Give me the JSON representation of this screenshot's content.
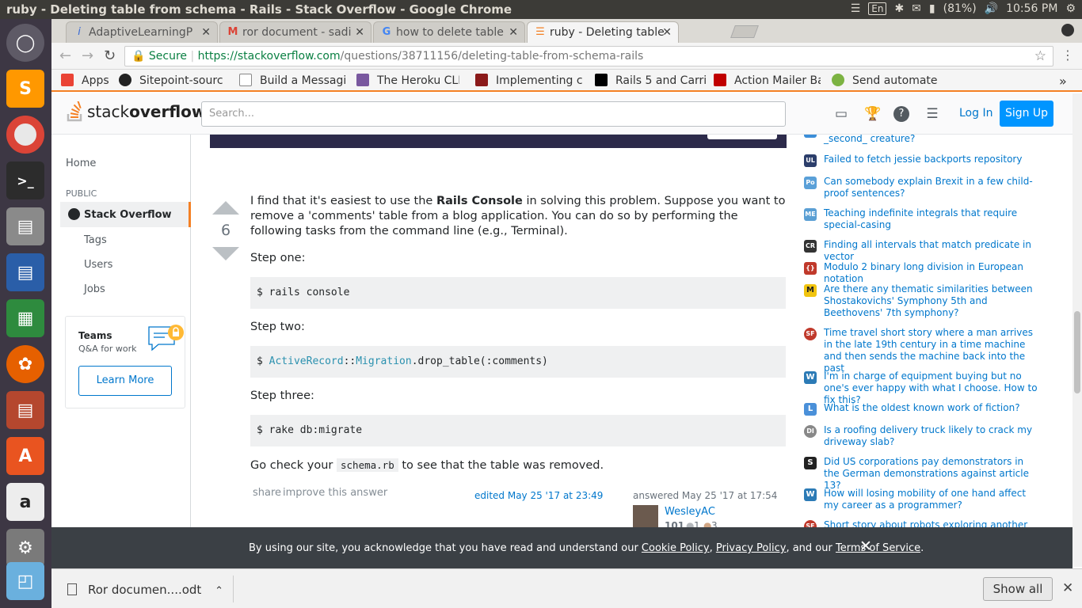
{
  "os": {
    "window_title": "ruby - Deleting table from schema - Rails - Stack Overflow - Google Chrome",
    "lang": "En",
    "battery": "(81%)",
    "time": "10:56 PM"
  },
  "browser": {
    "tabs": [
      {
        "label": "AdaptiveLearningP",
        "icon": "info-icon"
      },
      {
        "label": "ror document - sadi",
        "icon": "gmail-icon"
      },
      {
        "label": "how to delete table",
        "icon": "google-icon"
      },
      {
        "label": "ruby - Deleting table",
        "icon": "stackoverflow-icon"
      }
    ],
    "secure_label": "Secure",
    "url_host": "https://stackoverflow.com",
    "url_path": "/questions/38711156/deleting-table-from-schema-rails",
    "bookmarks": [
      {
        "label": "Apps",
        "color": "#ea4335"
      },
      {
        "label": "Sitepoint-sourc",
        "color": "#222222"
      },
      {
        "label": "Build a Messagi",
        "color": "#888888"
      },
      {
        "label": "The Heroku CLI",
        "color": "#79589f"
      },
      {
        "label": "Implementing c",
        "color": "#8b1a1a"
      },
      {
        "label": "Rails 5 and Carri",
        "color": "#000000"
      },
      {
        "label": "Action Mailer Ba",
        "color": "#c00000"
      },
      {
        "label": "Send automate",
        "color": "#7cb342"
      }
    ]
  },
  "so": {
    "logo_a": "stack",
    "logo_b": "overflow",
    "search_placeholder": "Search...",
    "login": "Log In",
    "signup": "Sign Up",
    "nav": {
      "home": "Home",
      "public": "PUBLIC",
      "stackoverflow": "Stack Overflow",
      "tags": "Tags",
      "users": "Users",
      "jobs": "Jobs"
    },
    "teams": {
      "title": "Teams",
      "subtitle": "Q&A for work",
      "button": "Learn More"
    }
  },
  "answer": {
    "votes": "6",
    "intro_a": "I find that it's easiest to use the ",
    "intro_bold": "Rails Console",
    "intro_b": " in solving this problem. Suppose you want to remove a 'comments' table from a blog application. You can do so by performing the following tasks from the command line (e.g., Terminal).",
    "step1": "Step one:",
    "code1": "$ rails console",
    "step2": "Step two:",
    "code2_prefix": "$ ",
    "code2_type1": "ActiveRecord",
    "code2_sep": "::",
    "code2_type2": "Migration",
    "code2_rest": ".drop_table(:comments)",
    "step3": "Step three:",
    "code3": "$ rake db:migrate",
    "outro_a": "Go check your ",
    "outro_code": "schema.rb",
    "outro_b": " to see that the table was removed.",
    "share": "share",
    "improve": "improve this answer",
    "edited": "edited May 25 '17 at 23:49",
    "answered": "answered May 25 '17 at 17:54",
    "user": "WesleyAC",
    "rep": "101",
    "silver": "1",
    "bronze": "3"
  },
  "hot_questions": [
    {
      "text": "_second_ creature?",
      "color": "#3b8ed8",
      "glyph": ""
    },
    {
      "text": "Failed to fetch jessie backports repository",
      "color": "#2c3e6b",
      "glyph": "UL"
    },
    {
      "text": "Can somebody explain Brexit in a few child-proof sentences?",
      "color": "#5aa0d8",
      "glyph": "Po"
    },
    {
      "text": "Teaching indefinite integrals that require special-casing",
      "color": "#5a9fd4",
      "glyph": "ME"
    },
    {
      "text": "Finding all intervals that match predicate in vector",
      "color": "#333333",
      "glyph": "CR"
    },
    {
      "text": "Modulo 2 binary long division in European notation",
      "color": "#c0392b",
      "glyph": "{}"
    },
    {
      "text": "Are there any thematic similarities between Shostakovichs' Symphony 5th and Beethovens' 7th symphony?",
      "color": "#f1c40f",
      "glyph": "M"
    },
    {
      "text": "Time travel short story where a man arrives in the late 19th century in a time machine and then sends the machine back into the past",
      "color": "#c0392b",
      "glyph": "SF"
    },
    {
      "text": "I'm in charge of equipment buying but no one's ever happy with what I choose. How to fix this?",
      "color": "#2c7bb6",
      "glyph": "W"
    },
    {
      "text": "What is the oldest known work of fiction?",
      "color": "#4a90d9",
      "glyph": "L"
    },
    {
      "text": "Is a roofing delivery truck likely to crack my driveway slab?",
      "color": "#888888",
      "glyph": "DI"
    },
    {
      "text": "Did US corporations pay demonstrators in the German demonstrations against article 13?",
      "color": "#222222",
      "glyph": "S"
    },
    {
      "text": "How will losing mobility of one hand affect my career as a programmer?",
      "color": "#2c7bb6",
      "glyph": "W"
    },
    {
      "text": "Short story about robots exploring another planet",
      "color": "#c0392b",
      "glyph": "SF"
    }
  ],
  "cookie": {
    "text_a": "By using our site, you acknowledge that you have read and understand our ",
    "cookie_policy": "Cookie Policy",
    "sep1": ", ",
    "privacy_policy": "Privacy Policy",
    "sep2": ", and our ",
    "terms": "Terms of Service",
    "end": "."
  },
  "download": {
    "file": "Ror documen....odt",
    "show_all": "Show all"
  }
}
